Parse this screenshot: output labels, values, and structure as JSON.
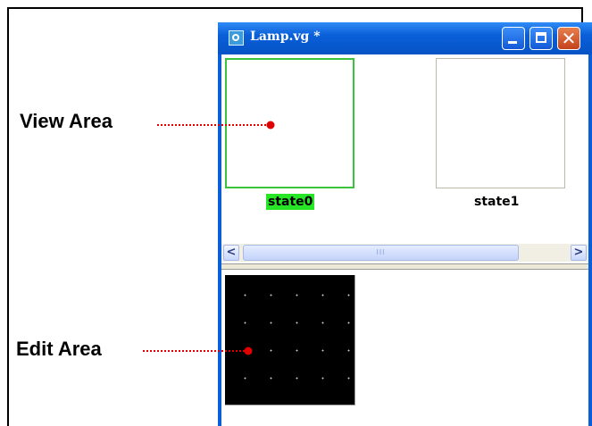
{
  "window": {
    "title": "Lamp.vg *",
    "controls": {
      "minimize": "_",
      "maximize": "□",
      "close": "✕"
    }
  },
  "view_area": {
    "states": [
      {
        "label": "state0",
        "selected": true
      },
      {
        "label": "state1",
        "selected": false
      }
    ],
    "scrollbar": {
      "left_arrow": "<",
      "right_arrow": ">",
      "thumb_grip": "III"
    }
  },
  "annotations": {
    "view_area_label": "View Area",
    "edit_area_label": "Edit Area",
    "leader_color": "#e00000"
  },
  "colors": {
    "selected_border": "#3bc43b",
    "selected_label_bg": "#26e626",
    "titlebar": "#0a5fd8",
    "canvas": "#000000"
  },
  "icons": [
    "app-icon",
    "minimize-icon",
    "maximize-icon",
    "close-icon",
    "scroll-left-icon",
    "scroll-right-icon"
  ]
}
